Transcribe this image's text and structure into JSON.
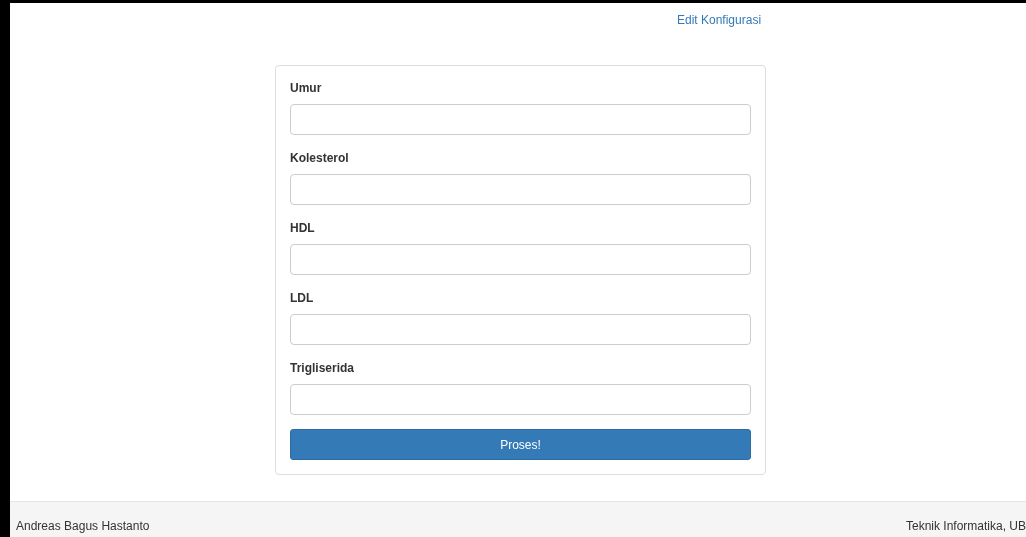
{
  "header_link": "Edit Konfigurasi",
  "fields": [
    {
      "label": "Umur"
    },
    {
      "label": "Kolesterol"
    },
    {
      "label": "HDL"
    },
    {
      "label": "LDL"
    },
    {
      "label": "Trigliserida"
    }
  ],
  "submit_button": "Proses!",
  "footer": {
    "left": "Andreas Bagus Hastanto",
    "right": "Teknik Informatika, UB"
  }
}
